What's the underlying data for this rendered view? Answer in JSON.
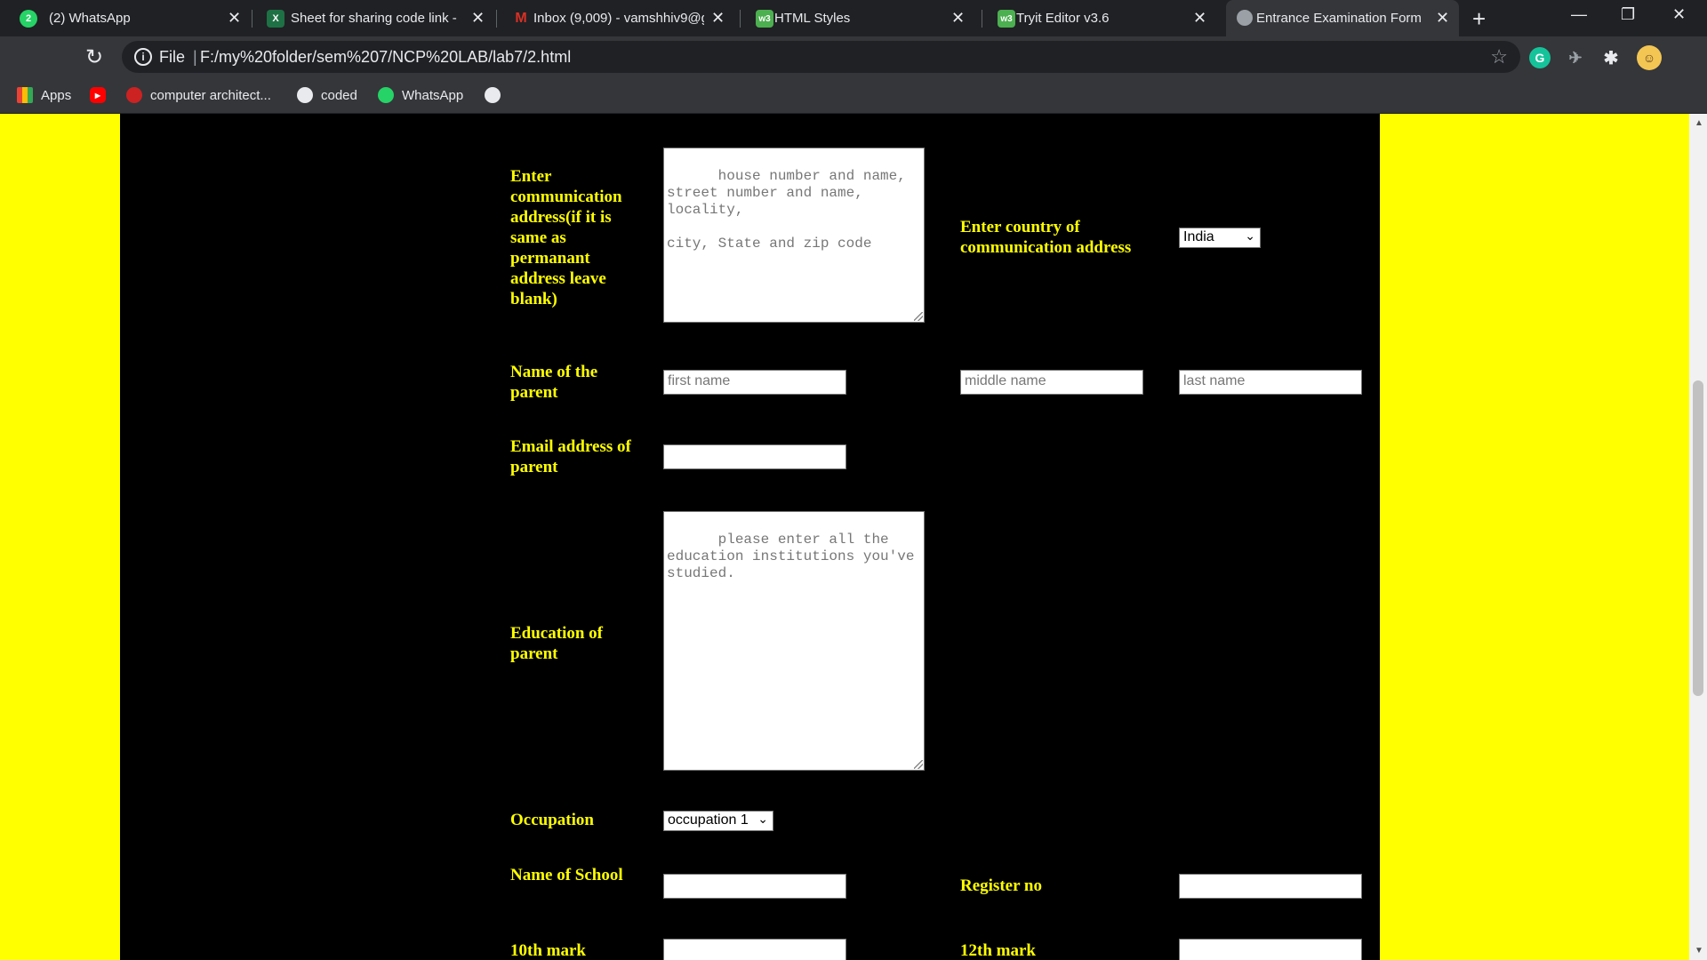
{
  "browser": {
    "tabs": [
      {
        "title": "(2) WhatsApp",
        "icon": "whatsapp-icon",
        "icon_text": "2",
        "icon_color": "#25d366"
      },
      {
        "title": "Sheet for sharing code link - ",
        "icon": "excel-icon",
        "icon_text": "X",
        "icon_color": "#1e7145"
      },
      {
        "title": "Inbox (9,009) - vamshhiv9@g",
        "icon": "gmail-icon",
        "icon_text": "M",
        "icon_color": "#d93025"
      },
      {
        "title": "HTML Styles",
        "icon": "w3schools-icon",
        "icon_text": "w3",
        "icon_color": "#4caf50"
      },
      {
        "title": "Tryit Editor v3.6",
        "icon": "w3schools-icon",
        "icon_text": "w3",
        "icon_color": "#4caf50"
      },
      {
        "title": "Entrance Examination Form",
        "icon": "globe-icon",
        "icon_text": "",
        "icon_color": "#9aa0a6"
      }
    ],
    "close_glyph": "✕",
    "new_tab": "+",
    "win_minimize": "—",
    "win_restore": "❐",
    "win_close": "✕",
    "reload": "↻",
    "address": {
      "scheme_label": "File",
      "separator": "|",
      "url": "F:/my%20folder/sem%207/NCP%20LAB/lab7/2.html"
    },
    "star": "☆",
    "bookmarks": [
      {
        "label": "Apps",
        "icon": "apps-grid-icon"
      },
      {
        "label": "",
        "icon": "youtube-icon"
      },
      {
        "label": "computer architect...",
        "icon": "bookmark-favicon-icon"
      },
      {
        "label": "coded",
        "icon": "globe-icon"
      },
      {
        "label": "WhatsApp",
        "icon": "whatsapp-icon"
      },
      {
        "label": "",
        "icon": "globe-icon"
      }
    ]
  },
  "form": {
    "comm_address_label": "Enter communication address(if it is same as permanant address leave blank)",
    "comm_address_placeholder": "house number and name, street number and name, locality,\n\ncity, State and zip code",
    "comm_country_label": "Enter country of communication address",
    "comm_country_value": "India",
    "parent_name_label": "Name of the parent",
    "first_name_placeholder": "first name",
    "middle_name_placeholder": "middle name",
    "last_name_placeholder": "last name",
    "parent_email_label": "Email address of parent",
    "parent_education_label": "Education of parent",
    "parent_education_placeholder": "please enter all the education institutions you've studied.",
    "occupation_label": "Occupation",
    "occupation_value": "occupation 1",
    "school_name_label": "Name of School",
    "register_no_label": "Register no",
    "tenth_mark_label": "10th mark",
    "twelfth_mark_label": "12th mark"
  },
  "colors": {
    "page_bg": "#ffff00",
    "panel_bg": "#000000",
    "label_color": "#ffff00"
  }
}
